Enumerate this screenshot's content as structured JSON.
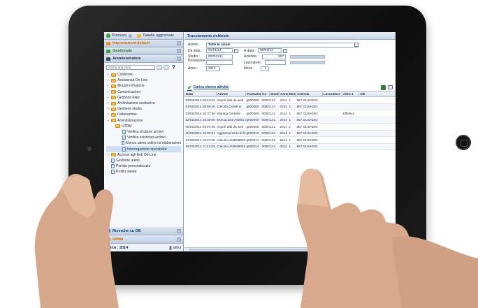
{
  "sidebar": {
    "top_tabs": [
      "Processi",
      "Tabelle aggiornate"
    ],
    "sections": [
      {
        "label": "Impostazioni default",
        "color": "#d66b00"
      },
      {
        "label": "Gestionale",
        "color": "#2a7a2a"
      },
      {
        "label": "Amministratore",
        "color": "#1b2a3d"
      }
    ],
    "search_placeholder": "Cerca una voce",
    "help_label": "?",
    "tree": [
      {
        "label": "Conferme",
        "level": 0,
        "kind": "folder",
        "toggle": "+"
      },
      {
        "label": "Assistenza On-Line",
        "level": 0,
        "kind": "folder",
        "toggle": "+"
      },
      {
        "label": "Moduli e Pratiche",
        "level": 0,
        "kind": "folder",
        "toggle": "+"
      },
      {
        "label": "Comunicazioni",
        "level": 0,
        "kind": "folder",
        "toggle": "+"
      },
      {
        "label": "Gestione Files",
        "level": 0,
        "kind": "folder",
        "toggle": "+"
      },
      {
        "label": "Archiviazione sostitutiva",
        "level": 0,
        "kind": "folder",
        "toggle": "+"
      },
      {
        "label": "Gestione studio",
        "level": 0,
        "kind": "folder",
        "toggle": "+"
      },
      {
        "label": "Fatturazione",
        "level": 0,
        "kind": "folder",
        "toggle": "+"
      },
      {
        "label": "Amministrazione",
        "level": 0,
        "kind": "folder",
        "toggle": "+"
      },
      {
        "label": "UTRM",
        "level": 1,
        "kind": "folder",
        "toggle": "-"
      },
      {
        "label": "Verifica strutture archivi",
        "level": 2,
        "kind": "doc",
        "toggle": ""
      },
      {
        "label": "Verifica esistenza archivi",
        "level": 2,
        "kind": "doc",
        "toggle": ""
      },
      {
        "label": "Elenco utenti online ed elaborazioni",
        "level": 2,
        "kind": "doc",
        "toggle": ""
      },
      {
        "label": "Interrogazione operativita'",
        "level": 2,
        "kind": "doc",
        "toggle": "",
        "selected": true
      },
      {
        "label": "Accessi agli Enti On-Line",
        "level": 0,
        "kind": "folder",
        "toggle": "+"
      },
      {
        "label": "Gestione utenti",
        "level": 0,
        "kind": "doc",
        "toggle": ""
      },
      {
        "label": "Portale personalizzato",
        "level": 0,
        "kind": "doc",
        "toggle": ""
      },
      {
        "label": "Profilo utente",
        "level": 0,
        "kind": "doc",
        "toggle": ""
      }
    ],
    "bottom_sections": [
      {
        "label": "Ricerche su DB",
        "color": "#0d3f73"
      },
      {
        "label": "Utilità",
        "color": "#d66b00"
      }
    ],
    "status_left": "Anno : 2014",
    "status_right": "attivi"
  },
  "main": {
    "title": "Tracciamento richieste",
    "form": {
      "azioni_label": "Azioni :",
      "azioni_value": "Tutte le azioni",
      "da_data_label": "Da data :",
      "da_data_value": "01/01/14",
      "a_data_label": "A data :",
      "a_data_value": "05/04/14",
      "studio_label": "Studio :",
      "studio_value": "00001121",
      "azienda_label": "Azienda :",
      "azienda_value": "957",
      "postazione_label": "Postazione :",
      "lavoratore_label": "Lavoratore :",
      "anno_label": "Anno :",
      "anno_value": "2014",
      "mese_label": "Mese :",
      "mese_value": "1"
    },
    "load_label": "Carica elenco attivita'",
    "columns": [
      "Data",
      "Azione",
      "Postazione",
      "Co",
      "Studio",
      "Anno",
      "Mese",
      "Azienda",
      "Lavoratore",
      "Altro 1",
      "Altr"
    ],
    "rows": [
      [
        "03/02/2014 09:44:04",
        "Import dati da web",
        "g000000",
        "00001",
        "121",
        "2014",
        "1",
        "957 GUSADIO",
        "",
        "",
        ""
      ],
      [
        "03/02/2014 09:59:26",
        "Calcolo Cedolino",
        "g000000",
        "00001",
        "121",
        "2014",
        "1",
        "957 GUSADIO",
        "",
        "",
        ""
      ],
      [
        "03/02/2014 16:37:59",
        "Stampa Cedolini",
        "g000000",
        "00001",
        "121",
        "2014",
        "1",
        "957 GUSADIO",
        "",
        "Effettiva",
        ""
      ],
      [
        "03/02/2014 16:38:58",
        "Esecuzione Attività Sche",
        "g000000",
        "00001",
        "121",
        "2014",
        "1",
        "957 GUSADIO",
        "",
        "",
        ""
      ],
      [
        "05/02/2014 09:07:35",
        "Import dati da web",
        "g000000",
        "00001",
        "121",
        "2014",
        "1",
        "957 GUSADIO",
        "",
        "",
        ""
      ],
      [
        "20/02/2014 16:30:31",
        "Aggiornamento di fine m",
        "g000013",
        "00001",
        "121",
        "2014",
        "1",
        "957 GUSADIO",
        "",
        "",
        ""
      ],
      [
        "24/02/2014 16:27:26",
        "Calcolo UNIEMENS",
        "g000014",
        "00001",
        "121",
        "2014",
        "1",
        "957 GUSADIO",
        "",
        "",
        ""
      ],
      [
        "25/02/2014 11:21:53",
        "Calcolo UNIEMENS",
        "g000014",
        "00001",
        "121",
        "2014",
        "1",
        "957 GUSADIO",
        "",
        "",
        ""
      ]
    ]
  }
}
